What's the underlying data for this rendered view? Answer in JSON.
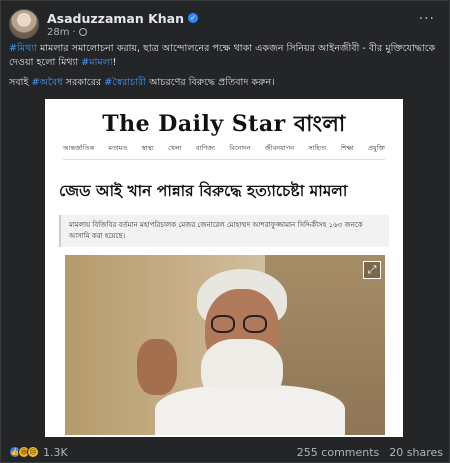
{
  "post": {
    "author": "Asaduzzaman Khan",
    "time": "28m",
    "privacy_icon": "globe-icon",
    "more_label": "···"
  },
  "text": {
    "line1_tag1": "#মিথ্যা",
    "line1_rest": " মামলার সমালোচনা করায়, ছাত্র আন্দোলনের পক্ষে থাকা একজন সিনিয়র আইনজীবী - বীর মুক্তিযোদ্ধাকে দেওয়া হলো মিথ্যা ",
    "line1_tag2": "#মামলা",
    "line1_end": "!",
    "line2_start": "সবাই ",
    "line2_tag1": "#অবৈধ",
    "line2_mid": " সরকারের ",
    "line2_tag2": "#স্বৈরাচারী",
    "line2_end": " আচরণের বিরুদ্ধে প্রতিবাদ করুন।"
  },
  "card": {
    "logo": "The Daily Star বাংলা",
    "nav": [
      "আন্তর্জাতিক",
      "মতামত",
      "স্বাস্থ্য",
      "খেলা",
      "বাণিজ্য",
      "বিনোদন",
      "জীবনযাপন",
      "সাহিত্য",
      "শিক্ষা",
      "প্রযুক্তি"
    ],
    "headline": "জেড আই খান পান্নার বিরুদ্ধে হত্যাচেষ্টা মামলা",
    "summary": "মামলায় বিজিবির বর্তমান মহাপরিচালক মেজর জেনারেল মোহাম্মদ আশরাফুজ্জামান সিদ্দিকীসহ ১৬৩ জনকে আসামি করা হয়েছে।",
    "expand_icon": "expand-icon"
  },
  "footer": {
    "reactions_count": "1.3K",
    "comments": "255 comments",
    "shares": "20 shares"
  }
}
